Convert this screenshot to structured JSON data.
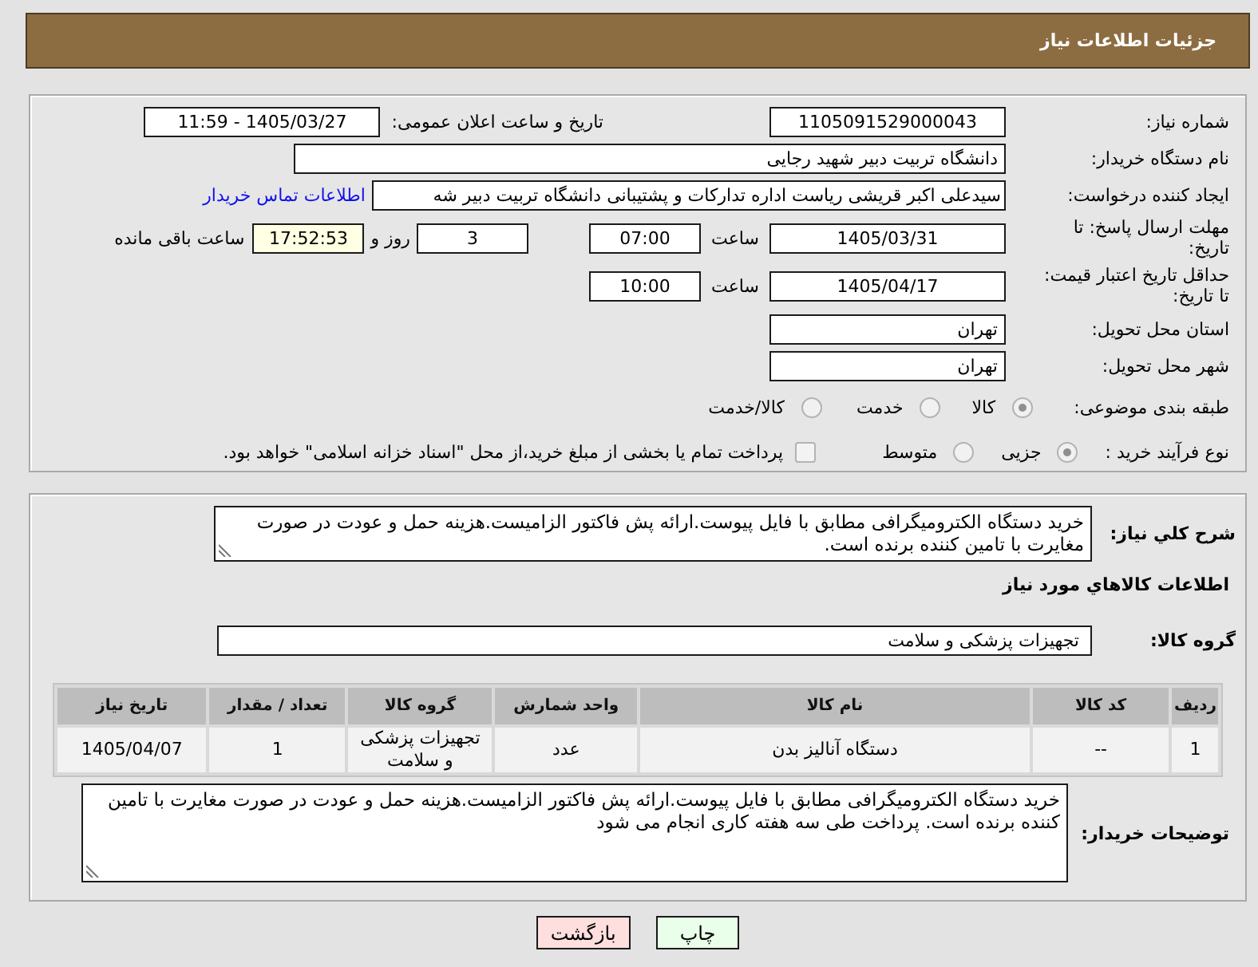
{
  "header": {
    "title": "جزئیات اطلاعات نیاز"
  },
  "details": {
    "need_number": {
      "label": "شماره نیاز:",
      "value": "1105091529000043"
    },
    "announcement": {
      "label": "تاریخ و ساعت اعلان عمومی:",
      "value": "1405/03/27 - 11:59"
    },
    "buyer": {
      "label": "نام دستگاه خریدار:",
      "value": "دانشگاه تربیت دبیر شهید رجایی"
    },
    "requester": {
      "label": "ایجاد کننده درخواست:",
      "value": "سیدعلی اکبر قریشی ریاست اداره تدارکات و پشتیبانی دانشگاه تربیت دبیر شه",
      "link": "اطلاعات تماس خریدار"
    },
    "reply_deadline": {
      "label": "مهلت ارسال پاسخ: تا تاریخ:",
      "date": "1405/03/31",
      "time_label": "ساعت",
      "time": "07:00",
      "days": "3",
      "days_label": "روز و",
      "remaining": "17:52:53",
      "remaining_label": "ساعت باقی مانده"
    },
    "price_validity": {
      "label": "حداقل تاریخ اعتبار قیمت: تا تاریخ:",
      "date": "1405/04/17",
      "time_label": "ساعت",
      "time": "10:00"
    },
    "province": {
      "label": "استان محل تحویل:",
      "value": "تهران"
    },
    "city": {
      "label": "شهر محل تحویل:",
      "value": "تهران"
    },
    "category": {
      "label": "طبقه بندی موضوعی:",
      "options": [
        {
          "label": "کالا",
          "selected": true
        },
        {
          "label": "خدمت",
          "selected": false
        },
        {
          "label": "کالا/خدمت",
          "selected": false
        }
      ]
    },
    "purchase_process": {
      "label": "نوع فرآیند خرید :",
      "options": [
        {
          "label": "جزیی",
          "selected": true
        },
        {
          "label": "متوسط",
          "selected": false
        }
      ],
      "treasury_payment": {
        "label": "پرداخت تمام یا بخشی از مبلغ خرید،از محل \"اسناد خزانه اسلامی\" خواهد بود.",
        "checked": false
      }
    }
  },
  "needs": {
    "description": {
      "label": "شرح کلي نياز:",
      "value": "خرید دستگاه الکترومیگرافی مطابق با فایل پیوست.ارائه پش فاکتور الزامیست.هزینه حمل و عودت در صورت مغایرت با تامین کننده برنده است."
    },
    "goods_title": "اطلاعات کالاهاي مورد نياز",
    "goods_group": {
      "label": "گروه کالا:",
      "value": "تجهیزات پزشکی و سلامت"
    },
    "table": {
      "columns": [
        "ردیف",
        "کد کالا",
        "نام کالا",
        "واحد شمارش",
        "گروه کالا",
        "تعداد / مقدار",
        "تاریخ نیاز"
      ],
      "rows": [
        [
          "1",
          "--",
          "دستگاه آنالیز بدن",
          "عدد",
          "تجهیزات پزشکی و سلامت",
          "1",
          "1405/04/07"
        ]
      ]
    },
    "buyer_notes": {
      "label": "توضیحات خریدار:",
      "value": "خرید دستگاه الکترومیگرافی مطابق با فایل پیوست.ارائه پش فاکتور الزامیست.هزینه حمل و عودت در صورت مغایرت با تامین کننده برنده است. پرداخت طی سه هفته کاری انجام می شود"
    }
  },
  "buttons": [
    {
      "kind": "print",
      "label": "چاپ"
    },
    {
      "kind": "back",
      "label": "بازگشت"
    }
  ]
}
